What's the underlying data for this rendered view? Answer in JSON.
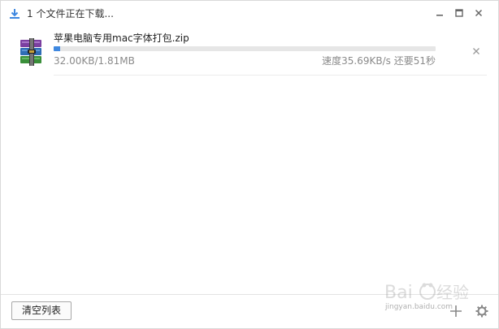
{
  "window": {
    "title": "1 个文件正在下载..."
  },
  "downloads": [
    {
      "file_name": "苹果电脑专用mac字体打包.zip",
      "size_progress": "32.00KB/1.81MB",
      "speed_remaining": "速度35.69KB/s 还要51秒",
      "progress_fraction": 0.017,
      "file_icon": "winrar-archive-icon"
    }
  ],
  "footer": {
    "clear_label": "清空列表"
  },
  "watermark": {
    "logo_text": "Baidu经验",
    "url_text": "jingyan.baidu.com"
  },
  "colors": {
    "accent": "#3f88e0",
    "muted_text": "#8a8a8a",
    "track": "#e6e6e6"
  }
}
